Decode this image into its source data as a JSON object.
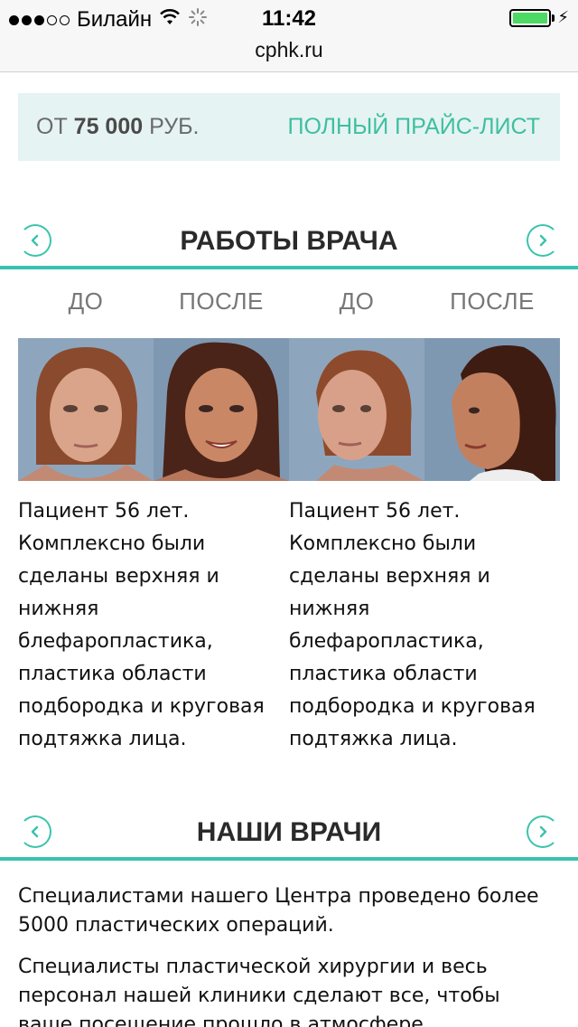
{
  "status_bar": {
    "carrier": "Билайн",
    "time": "11:42"
  },
  "browser": {
    "url": "cphk.ru"
  },
  "price": {
    "prefix": "ОТ",
    "amount": "75 000",
    "currency": "РУБ.",
    "link": "ПОЛНЫЙ ПРАЙС-ЛИСТ"
  },
  "works": {
    "title": "РАБОТЫ ВРАЧА",
    "labels": [
      "ДО",
      "ПОСЛЕ",
      "ДО",
      "ПОСЛЕ"
    ],
    "cases": [
      {
        "text": "Пациент 56 лет. Комплексно были сделаны верхняя и нижняя блефаропластика, пластика области подбородка и круговая подтяжка лица."
      },
      {
        "text": "Пациент 56 лет. Комплексно были сделаны верхняя и нижняя блефаропластика, пластика области подбородка и круговая подтяжка лица."
      }
    ]
  },
  "doctors": {
    "title": "НАШИ ВРАЧИ",
    "paragraph1": "Специалистами нашего Центра проведено более 5000 пластических операций.",
    "paragraph2": "Специалисты пластической хирургии и весь персонал нашей клиники сделают все, чтобы ваше посещение прошло в атмосфере"
  },
  "colors": {
    "accent": "#39c2b0",
    "price_bg": "#e6f3f3",
    "link": "#3dbfa0"
  },
  "icons": [
    "wifi-icon",
    "loading-spinner-icon",
    "battery-icon",
    "charging-bolt-icon",
    "arrow-left-icon",
    "arrow-right-icon"
  ]
}
